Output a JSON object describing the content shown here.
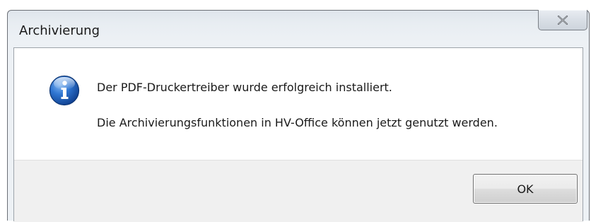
{
  "dialog": {
    "title": "Archivierung",
    "close_icon": "close-x-icon",
    "message_icon": "info-icon",
    "message_line1": "Der PDF-Druckertreiber wurde erfolgreich installiert.",
    "message_line2": "Die Archivierungsfunktionen in HV-Office können jetzt genutzt werden.",
    "ok_label": "OK"
  },
  "colors": {
    "icon_blue": "#1f5fb4",
    "footer_bg": "#f0f0f0"
  }
}
